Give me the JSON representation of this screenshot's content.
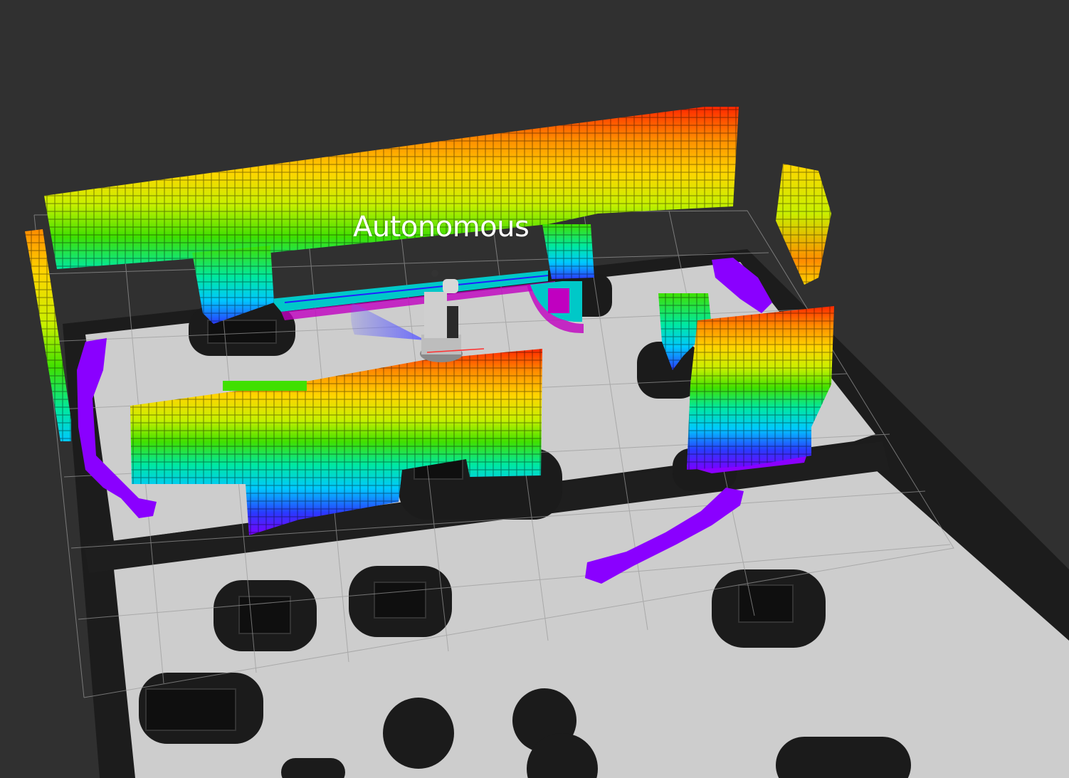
{
  "viewport": {
    "background_color": "#303030"
  },
  "status_label": "Autonomous",
  "colors": {
    "free_space": "#cdcdcd",
    "occupied": "#1a1a1a",
    "inflation": "#2a2a2a",
    "grid_lines": "#a0a0a0",
    "voxel_gradient": [
      "#7a00ff",
      "#2a3aff",
      "#00c8ff",
      "#00e8a0",
      "#40e000",
      "#c8f000",
      "#ffd400",
      "#ff8c00",
      "#ff2800"
    ],
    "costmap_cyan": "#00c8c8",
    "costmap_magenta": "#c000c0",
    "laser_purple": "#8a00ff",
    "robot_body": "#b8b8b8"
  },
  "icons": [
    "robot-model",
    "laser-scan-fan"
  ]
}
